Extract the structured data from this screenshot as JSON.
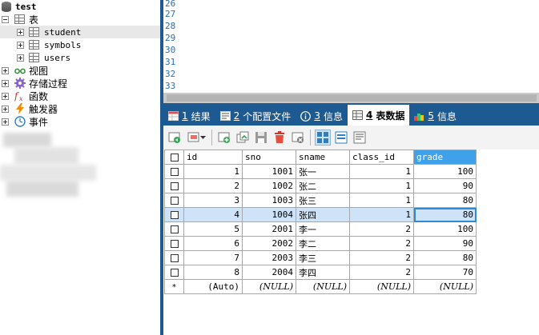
{
  "tree": {
    "database": "test",
    "tables_group": "表",
    "tables": [
      "student",
      "symbols",
      "users"
    ],
    "groups": [
      {
        "label": "视图",
        "icon": "view-icon"
      },
      {
        "label": "存储过程",
        "icon": "gear-icon"
      },
      {
        "label": "函数",
        "icon": "function-icon"
      },
      {
        "label": "触发器",
        "icon": "lightning-icon"
      },
      {
        "label": "事件",
        "icon": "clock-icon"
      }
    ]
  },
  "editor": {
    "line_numbers": [
      "26",
      "27",
      "28",
      "29",
      "30",
      "31",
      "32",
      "33"
    ]
  },
  "tabs": [
    {
      "num": "1",
      "label": "结果",
      "icon": "result-grid-icon"
    },
    {
      "num": "2",
      "label": "个配置文件",
      "icon": "profile-icon"
    },
    {
      "num": "3",
      "label": "信息",
      "icon": "info-icon"
    },
    {
      "num": "4",
      "label": "表数据",
      "icon": "table-data-icon",
      "active": true
    },
    {
      "num": "5",
      "label": "信息",
      "icon": "info-icon"
    }
  ],
  "grid": {
    "columns": [
      "id",
      "sno",
      "sname",
      "class_id",
      "grade"
    ],
    "rows": [
      [
        "1",
        "1001",
        "张一",
        "1",
        "100"
      ],
      [
        "2",
        "1002",
        "张二",
        "1",
        "90"
      ],
      [
        "3",
        "1003",
        "张三",
        "1",
        "80"
      ],
      [
        "4",
        "1004",
        "张四",
        "1",
        "80"
      ],
      [
        "5",
        "2001",
        "李一",
        "2",
        "100"
      ],
      [
        "6",
        "2002",
        "李二",
        "2",
        "90"
      ],
      [
        "7",
        "2003",
        "李三",
        "2",
        "80"
      ],
      [
        "8",
        "2004",
        "李四",
        "2",
        "70"
      ]
    ],
    "new_row": {
      "marker": "*",
      "id": "(Auto)",
      "sno": "(NULL)",
      "sname": "(NULL)",
      "class_id": "(NULL)",
      "grade": "(NULL)"
    }
  },
  "colors": {
    "accent": "#1d5a91",
    "selected_header": "#3ea1ea",
    "selected_row": "#cfe3f8",
    "line_numbers": "#2c6db3"
  }
}
